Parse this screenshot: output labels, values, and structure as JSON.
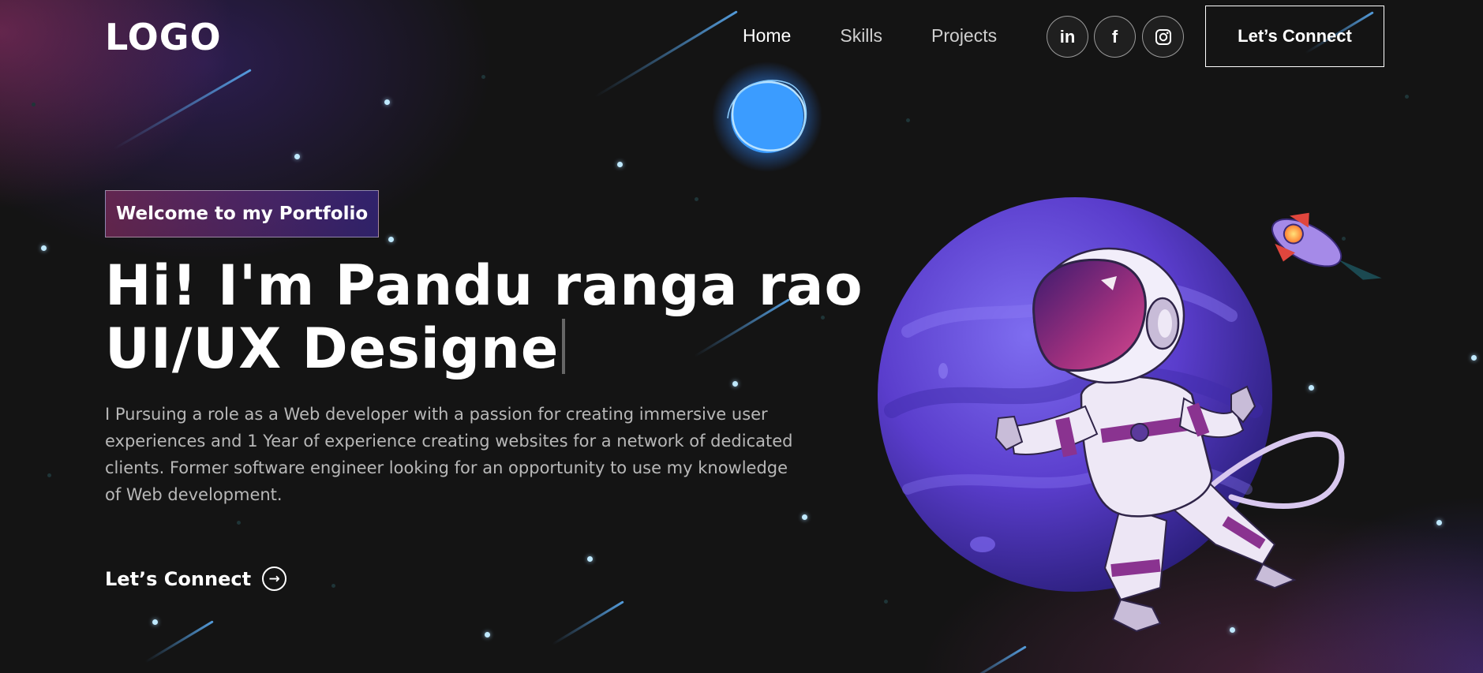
{
  "header": {
    "logo": "LOGO",
    "nav": [
      {
        "label": "Home",
        "active": true
      },
      {
        "label": "Skills",
        "active": false
      },
      {
        "label": "Projects",
        "active": false
      }
    ],
    "social": [
      {
        "icon": "linkedin-icon",
        "glyph": "in"
      },
      {
        "icon": "facebook-icon",
        "glyph": "f"
      },
      {
        "icon": "instagram-icon",
        "glyph": "ig"
      }
    ],
    "connect_button": "Let’s Connect"
  },
  "hero": {
    "tagline": "Welcome to my Portfolio",
    "headline_line1": "Hi! I'm Pandu ranga rao",
    "headline_line2": "UI/UX Designe",
    "description": "I Pursuing a role as a Web developer with a passion for creating immersive user experiences and 1 Year of experience creating websites for a network of dedicated clients. Former software engineer looking for an opportunity to use my knowledge of Web development.",
    "cta_label": "Let’s Connect",
    "cta_icon": "arrow-right-circle-icon"
  },
  "colors": {
    "background": "#121212",
    "accent_pink": "#aa367c",
    "accent_purple": "#4a2fbd",
    "star": "#bfe9ff"
  }
}
